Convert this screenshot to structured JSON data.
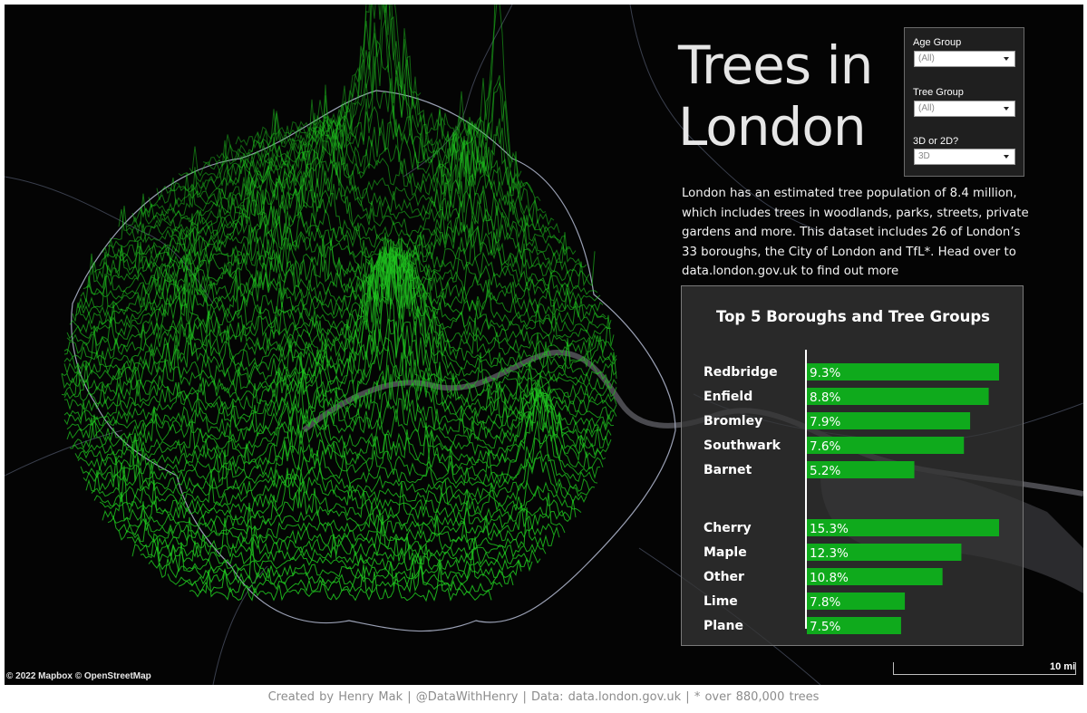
{
  "title_lines": [
    "Trees in",
    "London"
  ],
  "description": "London has an estimated tree population of 8.4 million, which includes trees in woodlands, parks, streets, private gardens and more. This dataset includes 26 of London’s 33 boroughs, the City of London and TfL*. Head over to data.london.gov.uk to find out more",
  "filters": {
    "age_group": {
      "label": "Age Group",
      "value": "(All)"
    },
    "tree_group": {
      "label": "Tree Group",
      "value": "(All)"
    },
    "dimension": {
      "label": "3D or 2D?",
      "value": "3D"
    }
  },
  "map": {
    "attribution": "© 2022 Mapbox  © OpenStreetMap",
    "scale_label": "10 mi",
    "background_color": "#040404",
    "ridge_color": "#1fc41f",
    "boundary_color": "#9aa0b4"
  },
  "footer": "Created by Henry Mak   |   @DataWithHenry   |   Data: data.london.gov.uk   |   * over 880,000 trees",
  "chart_data": [
    {
      "type": "bar",
      "orientation": "horizontal",
      "title": "Top 5 Boroughs and Tree Groups",
      "categories": [
        "Redbridge",
        "Enfield",
        "Bromley",
        "Southwark",
        "Barnet"
      ],
      "values": [
        9.3,
        8.8,
        7.9,
        7.6,
        5.2
      ],
      "labels": [
        "9.3%",
        "8.8%",
        "7.9%",
        "7.6%",
        "5.2%"
      ],
      "bar_color": "#0faa1c"
    },
    {
      "type": "bar",
      "orientation": "horizontal",
      "categories": [
        "Cherry",
        "Maple",
        "Other",
        "Lime",
        "Plane"
      ],
      "values": [
        15.3,
        12.3,
        10.8,
        7.8,
        7.5
      ],
      "labels": [
        "15.3%",
        "12.3%",
        "10.8%",
        "7.8%",
        "7.5%"
      ],
      "bar_color": "#0faa1c"
    }
  ]
}
